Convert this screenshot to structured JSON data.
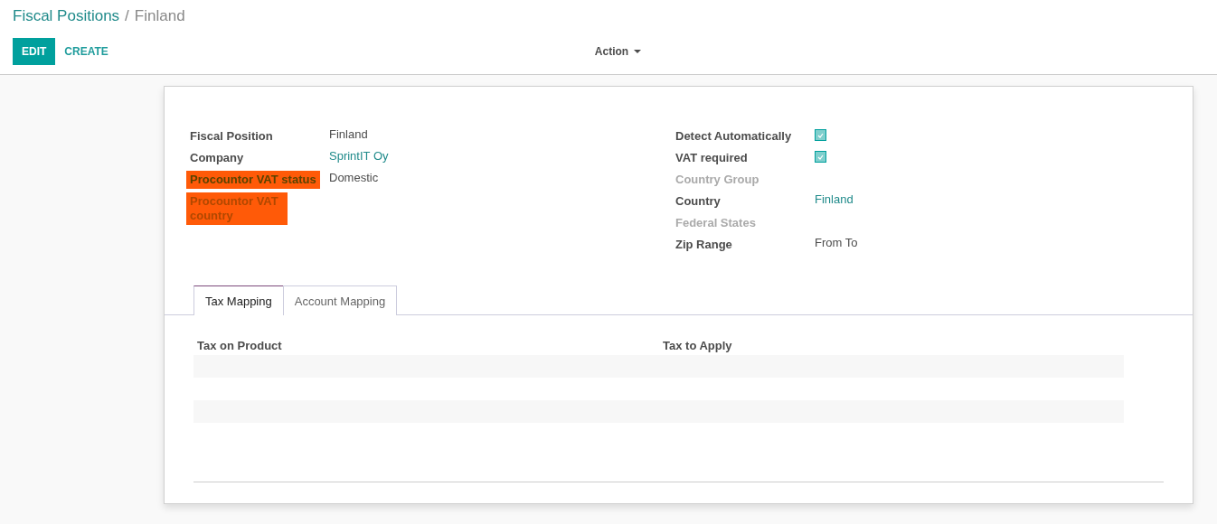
{
  "breadcrumb": {
    "parent": "Fiscal Positions",
    "separator": "/",
    "current": "Finland"
  },
  "buttons": [
    {
      "label": "EDIT",
      "kind": "primary"
    },
    {
      "label": "CREATE",
      "kind": "link"
    }
  ],
  "action_menu": {
    "label": "Action"
  },
  "left_fields": [
    {
      "label": "Fiscal Position",
      "value": "Finland",
      "kind": "text",
      "disabled": false,
      "highlighted": false
    },
    {
      "label": "Company",
      "value": "SprintIT Oy",
      "kind": "link",
      "disabled": false,
      "highlighted": false
    },
    {
      "label": "Procountor VAT status",
      "value": "Domestic",
      "kind": "text",
      "disabled": false,
      "highlighted": true
    },
    {
      "label": "Procountor VAT country",
      "kind": "text",
      "disabled": true,
      "highlighted": true
    }
  ],
  "right_fields": [
    {
      "label": "Detect Automatically",
      "kind": "checkbox",
      "checked": true,
      "disabled": false,
      "highlighted": false
    },
    {
      "label": "VAT required",
      "kind": "checkbox",
      "checked": true,
      "disabled": false,
      "highlighted": false
    },
    {
      "label": "Country Group",
      "kind": "text",
      "disabled": true,
      "highlighted": false
    },
    {
      "label": "Country",
      "value": "Finland",
      "kind": "link",
      "disabled": false,
      "highlighted": false
    },
    {
      "label": "Federal States",
      "kind": "text",
      "disabled": true,
      "highlighted": false
    },
    {
      "label": "Zip Range",
      "value": "From To",
      "kind": "text",
      "disabled": false,
      "highlighted": false
    }
  ],
  "tabs": [
    {
      "label": "Tax Mapping",
      "selected": true
    },
    {
      "label": "Account Mapping",
      "selected": false
    }
  ],
  "table": {
    "columns": [
      "Tax on Product",
      "Tax to Apply"
    ]
  }
}
